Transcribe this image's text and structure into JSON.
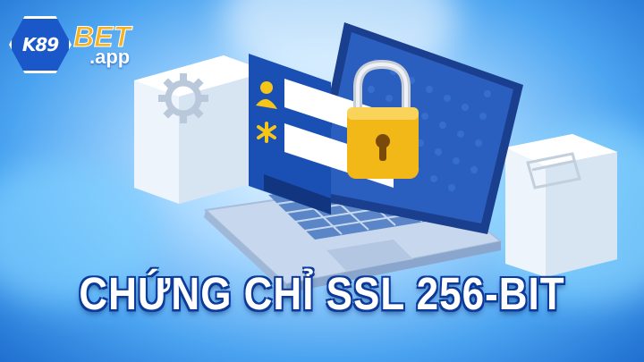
{
  "brand": {
    "logo_badge": "K89",
    "logo_word": "BET",
    "logo_suffix": ".app",
    "colors": {
      "badge": "#1a58c9",
      "bet": "#f5b324",
      "text": "#ffffff"
    }
  },
  "headline": "CHỨNG CHỈ SSL 256-BIT",
  "illustration": {
    "icons": [
      "gear-icon",
      "user-icon",
      "asterisk-icon",
      "padlock-icon",
      "card-icon"
    ]
  }
}
